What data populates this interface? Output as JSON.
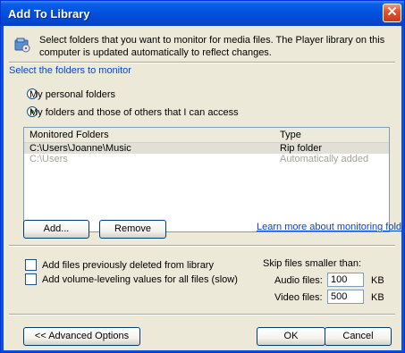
{
  "window": {
    "title": "Add To Library",
    "close_glyph": "✕"
  },
  "header": {
    "icon": "folder-media-icon",
    "text": "Select folders that you want to monitor for media files. The Player library on this computer is updated automatically to reflect changes."
  },
  "section_label": "Select the folders to monitor",
  "radio_options": [
    {
      "label": "My personal folders",
      "checked": false
    },
    {
      "label": "My folders and those of others that I can access",
      "checked": true
    }
  ],
  "folder_list": {
    "columns": [
      "Monitored Folders",
      "Type"
    ],
    "rows": [
      {
        "folder": "C:\\Users\\Joanne\\Music",
        "type": "Rip folder"
      },
      {
        "folder": "C:\\Users",
        "type": "Automatically added"
      }
    ]
  },
  "buttons": {
    "add": "Add...",
    "remove": "Remove",
    "advanced": "<< Advanced Options",
    "ok": "OK",
    "cancel": "Cancel"
  },
  "learn_more_link": "Learn more about monitoring folders",
  "checkboxes": [
    {
      "label": "Add files previously deleted from library",
      "checked": false
    },
    {
      "label": "Add volume-leveling values for all files (slow)",
      "checked": false
    }
  ],
  "skip": {
    "title": "Skip files smaller than:",
    "audio_label": "Audio files:",
    "audio_value": "100",
    "video_label": "Video files:",
    "video_value": "500",
    "unit": "KB"
  }
}
